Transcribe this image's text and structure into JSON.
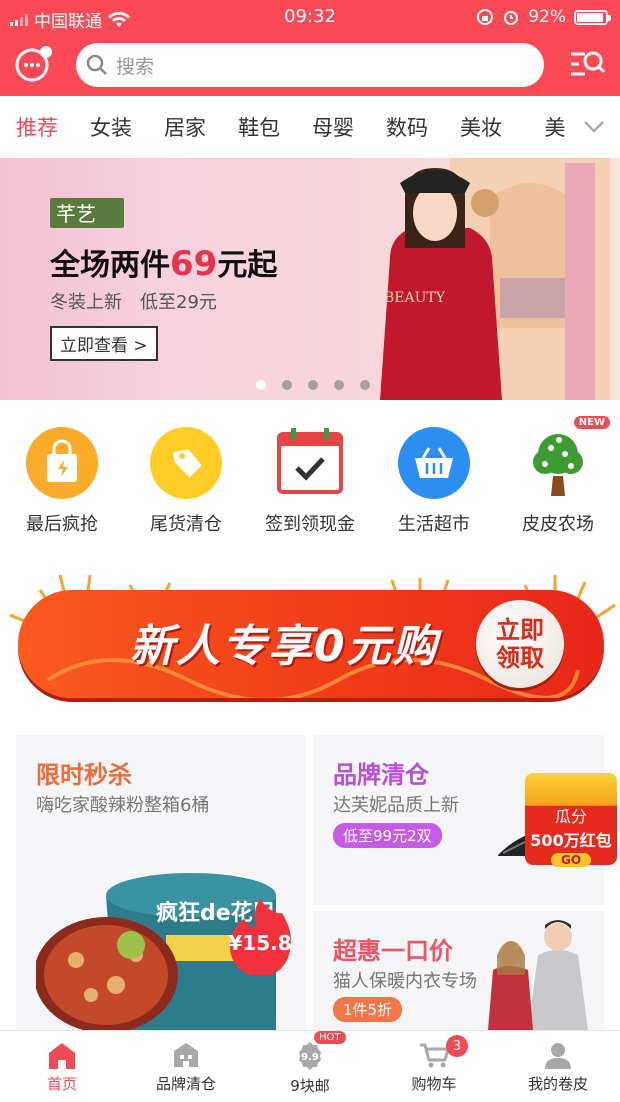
{
  "status": {
    "carrier": "中国联通",
    "time": "09:32",
    "battery": "92%"
  },
  "search": {
    "placeholder": "搜索"
  },
  "categories": [
    "推荐",
    "女装",
    "居家",
    "鞋包",
    "母婴",
    "数码",
    "美妆",
    "美"
  ],
  "banner": {
    "tag": "芊艺",
    "title_pre": "全场两件",
    "title_num": "69",
    "title_post": "元起",
    "sub": "冬装上新　低至29元",
    "button": "立即查看 >",
    "shirt_text": "BEAUTY"
  },
  "shortcuts": [
    {
      "label": "最后疯抢"
    },
    {
      "label": "尾货清仓"
    },
    {
      "label": "签到领现金"
    },
    {
      "label": "生活超市"
    },
    {
      "label": "皮皮农场",
      "badge": "NEW"
    }
  ],
  "promo": {
    "title": "新人专享0元购",
    "button": "立即领取"
  },
  "cards": {
    "flash": {
      "title": "限时秒杀",
      "sub": "嗨吃家酸辣粉整箱6桶",
      "price": "¥15.8",
      "product_text": "疯狂de花甲"
    },
    "brand": {
      "title": "品牌清仓",
      "sub": "达芙妮品质上新",
      "pill": "低至99元2双",
      "gift_line1": "瓜分",
      "gift_line2": "500万红包",
      "gift_btn": "GO"
    },
    "deal": {
      "title": "超惠一口价",
      "sub": "猫人保暖内衣专场",
      "pill": "1件5折"
    }
  },
  "tabs": [
    {
      "label": "首页"
    },
    {
      "label": "品牌清仓"
    },
    {
      "label": "9块邮",
      "badge": "HOT",
      "icon_text": "9.9"
    },
    {
      "label": "购物车",
      "badge": "3"
    },
    {
      "label": "我的卷皮"
    }
  ],
  "colors": {
    "brand": "#fb4a55",
    "accent": "#f04a55"
  }
}
